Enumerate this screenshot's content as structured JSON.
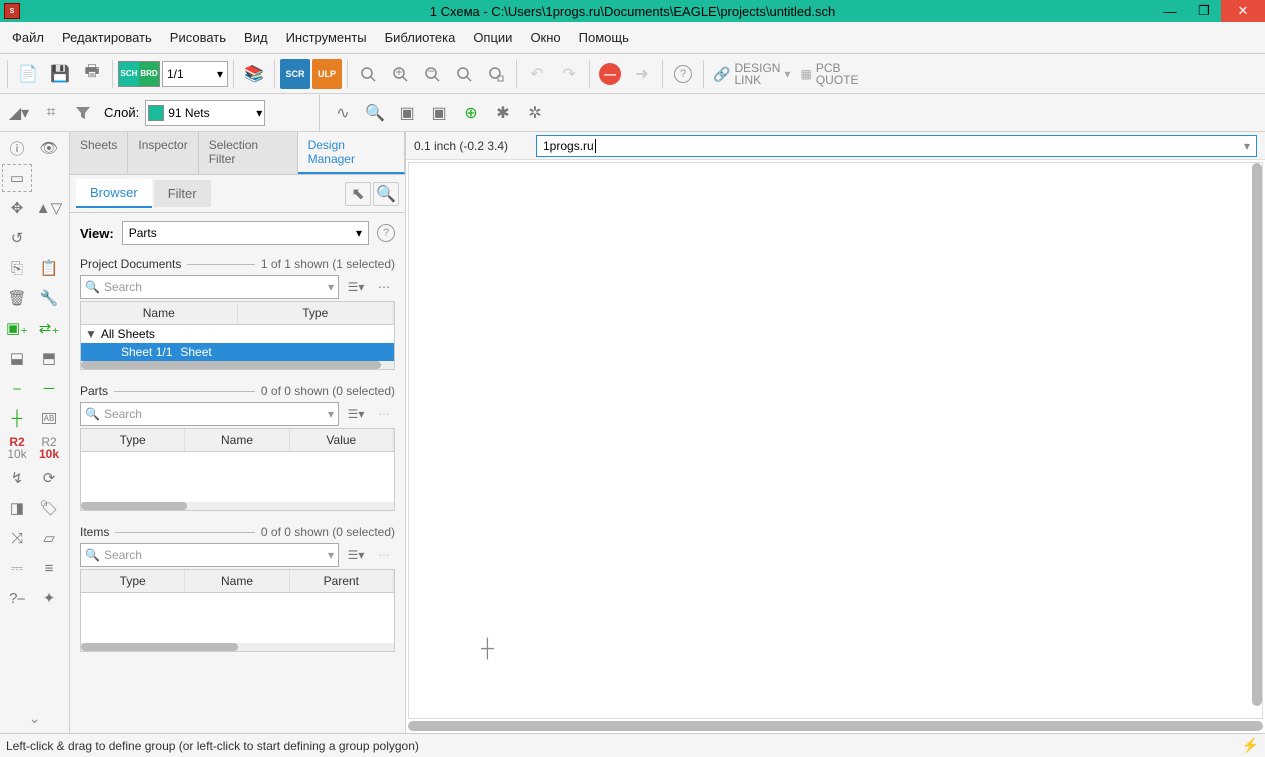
{
  "title": "1 Схема - C:\\Users\\1progs.ru\\Documents\\EAGLE\\projects\\untitled.sch",
  "menu": [
    "Файл",
    "Редактировать",
    "Рисовать",
    "Вид",
    "Инструменты",
    "Библиотека",
    "Опции",
    "Окно",
    "Помощь"
  ],
  "sheet_selector": "1/1",
  "brd_labels": {
    "sch": "SCH",
    "brd": "BRD"
  },
  "scrulp": {
    "scr": "SCR",
    "ulp": "ULP"
  },
  "designlink": {
    "l1": "DESIGN",
    "l2": "LINK"
  },
  "pcbquote": {
    "l1": "PCB",
    "l2": "QUOTE"
  },
  "layer_label": "Слой:",
  "layer_value": "91 Nets",
  "panel_tabs": [
    "Sheets",
    "Inspector",
    "Selection Filter",
    "Design Manager"
  ],
  "panel_active_index": 3,
  "subtabs": {
    "browser": "Browser",
    "filter": "Filter"
  },
  "view_label": "View:",
  "view_value": "Parts",
  "search_placeholder": "Search",
  "sections": {
    "docs": {
      "title": "Project Documents",
      "count": "1 of 1 shown (1 selected)",
      "cols": [
        "Name",
        "Type"
      ],
      "rows": {
        "root": "All Sheets",
        "child_name": "Sheet 1/1",
        "child_type": "Sheet"
      },
      "scroll_w": "96%"
    },
    "parts": {
      "title": "Parts",
      "count": "0 of 0 shown (0 selected)",
      "cols": [
        "Type",
        "Name",
        "Value"
      ],
      "scroll_w": "34%"
    },
    "items": {
      "title": "Items",
      "count": "0 of 0 shown (0 selected)",
      "cols": [
        "Type",
        "Name",
        "Parent"
      ],
      "scroll_w": "50%"
    }
  },
  "coords": "0.1 inch (-0.2 3.4)",
  "command": "1progs.ru",
  "status": "Left-click & drag to define group (or left-click to start defining a group polygon)",
  "dropdown_arrow": "▾",
  "chev_down": "»"
}
